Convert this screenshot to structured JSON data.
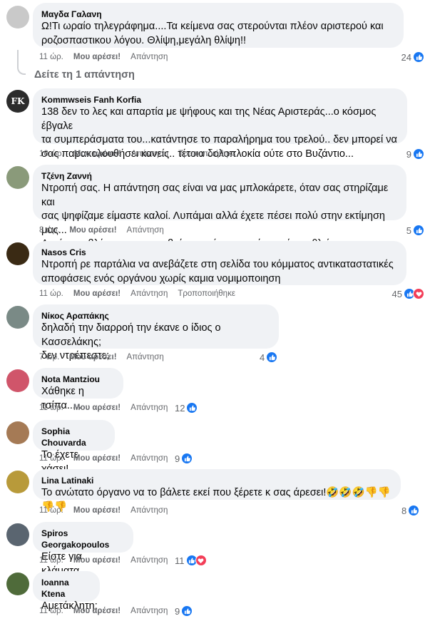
{
  "reply_thread": {
    "label": "Δείτε τη 1 απάντηση"
  },
  "comments": [
    {
      "author": "Μαγδα Γαλανη",
      "text": "Ω!Τι ωραίο τηλεγράφημα....Τα κείμενα σας στερούνται πλέον αριστερού και\nροζοσπαστικου λόγου. Θλίψη,μεγάλη θλίψη!!",
      "time": "11 ώρ.",
      "like": "Μου αρέσει!",
      "reply": "Απάντηση",
      "edited": "",
      "count": "24",
      "reactions": [
        "like"
      ],
      "avatar_color": "#c9c9c9"
    },
    {
      "author": "Kommwseis Fanh Korfia",
      "text": "138 δεν το λες και απαρτία με ψήφους και της Νέας Αριστεράς...ο κόσμος έβγαλε\nτα συμπεράσματα του...κατάντησε το παραλήρημα του τρελού.. δεν μπορεί να\nσας παρακολουθήσει κανείς.. τέτοια δολοπλοκία ούτε στο Βυζάντιο...",
      "time": "10 ώρ.",
      "like": "Μου αρέσει!",
      "reply": "Απάντηση",
      "edited": "Τροποποιήθηκε",
      "count": "9",
      "reactions": [
        "like"
      ],
      "avatar_color": "#2c2c2c",
      "avatar_text": "FK"
    },
    {
      "author": "Τζένη Ζαννή",
      "text": "Ντροπή σας. Η απάντηση σας είναι να μας μπλοκάρετε, όταν σας στηρίζαμε και\nσας ψηφίζαμε είμαστε καλοί. Λυπάμαι αλλά έχετε πέσει πολύ στην εκτίμηση μας...\nΑυτά που βλέπουμε να συμβαίνουν μέσα στο κόμμα είναι αθλιότητες...",
      "time": "8 ώρ.",
      "like": "Μου αρέσει!",
      "reply": "Απάντηση",
      "edited": "",
      "count": "5",
      "reactions": [
        "like"
      ],
      "avatar_color": "#8a9a7a"
    },
    {
      "author": "Nasos Cris",
      "text": "Ντροπή ρε παρτάλια να ανεβάζετε στη σελίδα του κόμματος αντικαταστατικές\nαποφάσεις ενός οργάνου χωρίς καμια νομιμοποιηση",
      "time": "11 ώρ.",
      "like": "Μου αρέσει!",
      "reply": "Απάντηση",
      "edited": "Τροποποιήθηκε",
      "count": "45",
      "reactions": [
        "like",
        "love"
      ],
      "avatar_color": "#3a2a14"
    },
    {
      "author": "Νίκος Αραπάκης",
      "text": "δηλαδή την διαρροή την έκανε ο ίδιος ο Κασσελάκης;\nδεν ντρέπεστε;",
      "time": "7 ώρ.",
      "like": "Μου αρέσει!",
      "reply": "Απάντηση",
      "edited": "",
      "count": "4",
      "reactions": [
        "like"
      ],
      "avatar_color": "#7a8a86"
    },
    {
      "author": "Nota Mantziou",
      "text": "Χάθηκε η τσίπα.....",
      "time": "11 ώρ.",
      "like": "Μου αρέσει!",
      "reply": "Απάντηση",
      "edited": "",
      "count": "12",
      "reactions": [
        "like"
      ],
      "avatar_color": "#d0556a"
    },
    {
      "author": "Sophia Chouvarda",
      "text": "Το έχετε χάσει!",
      "time": "11 ώρ.",
      "like": "Μου αρέσει!",
      "reply": "Απάντηση",
      "edited": "",
      "count": "9",
      "reactions": [
        "like"
      ],
      "avatar_color": "#a57a55"
    },
    {
      "author": "Lina Latinaki",
      "text": "Το ανώτατο όργανο να το βάλετε εκεί που ξέρετε κ σας άρεσει!🤣🤣🤣👎👎👎👎",
      "time": "11 ώρ.",
      "like": "Μου αρέσει!",
      "reply": "Απάντηση",
      "edited": "",
      "count": "8",
      "reactions": [
        "like"
      ],
      "avatar_color": "#b89a3a"
    },
    {
      "author": "Spiros Georgakopoulos",
      "text": "Είστε για κλάματα....",
      "time": "11 ώρ.",
      "like": "Μου αρέσει!",
      "reply": "Απάντηση",
      "edited": "",
      "count": "11",
      "reactions": [
        "like",
        "love"
      ],
      "avatar_color": "#5a6570"
    },
    {
      "author": "Ioanna Ktena",
      "text": "Αμετάκλητη;",
      "time": "11 ώρ.",
      "like": "Μου αρέσει!",
      "reply": "Απάντηση",
      "edited": "",
      "count": "9",
      "reactions": [
        "like"
      ],
      "avatar_color": "#4f6b3a"
    }
  ]
}
